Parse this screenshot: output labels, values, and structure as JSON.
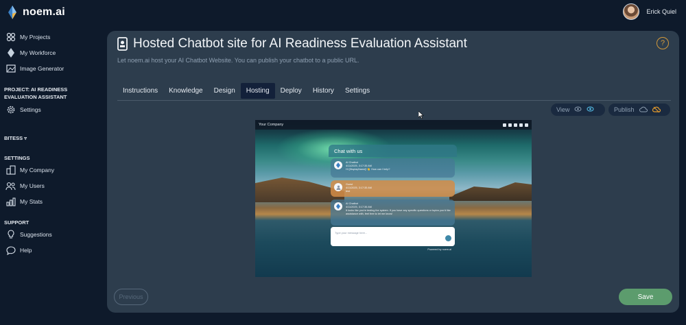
{
  "app": {
    "name": "noem.ai"
  },
  "user": {
    "name": "Erick Quiel"
  },
  "sidebar": {
    "items_top": [
      {
        "label": "My Projects",
        "icon": "projects-icon"
      },
      {
        "label": "My Workforce",
        "icon": "workforce-icon"
      },
      {
        "label": "Image Generator",
        "icon": "image-icon"
      }
    ],
    "project_heading": "PROJECT: AI READINESS EVALUATION ASSISTANT",
    "project_settings": "Settings",
    "bitess_heading": "BITESS",
    "settings_heading": "SETTINGS",
    "settings_items": [
      {
        "label": "My Company",
        "icon": "company-icon"
      },
      {
        "label": "My Users",
        "icon": "users-icon"
      },
      {
        "label": "My Stats",
        "icon": "stats-icon"
      }
    ],
    "support_heading": "SUPPORT",
    "support_items": [
      {
        "label": "Suggestions",
        "icon": "lightbulb-icon"
      },
      {
        "label": "Help",
        "icon": "chat-bubble-icon"
      }
    ]
  },
  "main": {
    "title": "Hosted Chatbot site for AI Readiness Evaluation Assistant",
    "subtitle": "Let noem.ai host your AI Chatbot Website. You can publish your chatbot to a public URL.",
    "tabs": [
      {
        "label": "Instructions"
      },
      {
        "label": "Knowledge"
      },
      {
        "label": "Design"
      },
      {
        "label": "Hosting",
        "active": true
      },
      {
        "label": "Deploy"
      },
      {
        "label": "History"
      },
      {
        "label": "Settings"
      }
    ],
    "view_label": "View",
    "publish_label": "Publish",
    "previous_label": "Previous",
    "save_label": "Save"
  },
  "preview": {
    "company": "Your Company",
    "chat_title": "Chat with us",
    "messages": [
      {
        "sender": "AI Chatbot",
        "time": "4/11/2025, 3:17:35 AM",
        "text": "Hi [DisplayName]! 👋 How can I help?"
      },
      {
        "sender": "Guest",
        "time": "4/11/2025, 3:17:35 AM",
        "text": "test"
      },
      {
        "sender": "AI Chatbot",
        "time": "4/11/2025, 3:17:36 AM",
        "text": "It looks like you're testing the system. If you have any specific questions or topics you'd like assistance with, feel free to let me know!"
      }
    ],
    "input_placeholder": "Type your message here...",
    "powered": "Powered by noem.ai"
  }
}
